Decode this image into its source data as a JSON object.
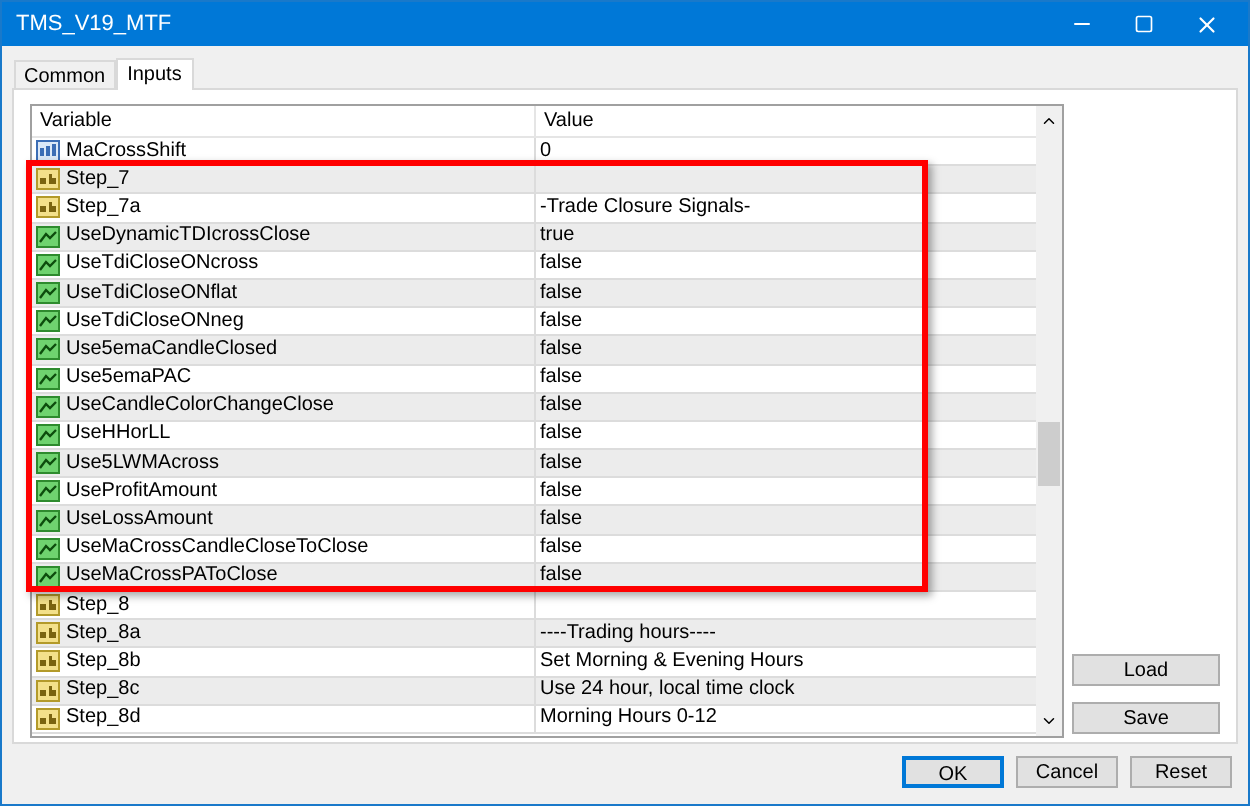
{
  "window": {
    "title": "TMS_V19_MTF"
  },
  "tabs": [
    {
      "label": "Common",
      "selected": false
    },
    {
      "label": "Inputs",
      "selected": true
    }
  ],
  "table": {
    "columns": [
      "Variable",
      "Value"
    ],
    "rows": [
      {
        "kind": "int",
        "variable": "MaCrossShift",
        "value": "0"
      },
      {
        "kind": "string",
        "variable": "Step_7",
        "value": ""
      },
      {
        "kind": "string",
        "variable": "Step_7a",
        "value": "-Trade Closure Signals-"
      },
      {
        "kind": "bool",
        "variable": "UseDynamicTDIcrossClose",
        "value": "true"
      },
      {
        "kind": "bool",
        "variable": "UseTdiCloseONcross",
        "value": "false"
      },
      {
        "kind": "bool",
        "variable": "UseTdiCloseONflat",
        "value": "false"
      },
      {
        "kind": "bool",
        "variable": "UseTdiCloseONneg",
        "value": "false"
      },
      {
        "kind": "bool",
        "variable": "Use5emaCandleClosed",
        "value": "false"
      },
      {
        "kind": "bool",
        "variable": "Use5emaPAC",
        "value": "false"
      },
      {
        "kind": "bool",
        "variable": "UseCandleColorChangeClose",
        "value": "false"
      },
      {
        "kind": "bool",
        "variable": "UseHHorLL",
        "value": "false"
      },
      {
        "kind": "bool",
        "variable": "Use5LWMAcross",
        "value": "false"
      },
      {
        "kind": "bool",
        "variable": "UseProfitAmount",
        "value": "false"
      },
      {
        "kind": "bool",
        "variable": "UseLossAmount",
        "value": "false"
      },
      {
        "kind": "bool",
        "variable": "UseMaCrossCandleCloseToClose",
        "value": "false"
      },
      {
        "kind": "bool",
        "variable": "UseMaCrossPAToClose",
        "value": "false"
      },
      {
        "kind": "string",
        "variable": "Step_8",
        "value": ""
      },
      {
        "kind": "string",
        "variable": "Step_8a",
        "value": "----Trading hours----"
      },
      {
        "kind": "string",
        "variable": "Step_8b",
        "value": "Set Morning & Evening Hours"
      },
      {
        "kind": "string",
        "variable": "Step_8c",
        "value": "Use 24 hour, local time clock"
      },
      {
        "kind": "string",
        "variable": "Step_8d",
        "value": "Morning Hours 0-12"
      }
    ]
  },
  "side_buttons": [
    "Load",
    "Save"
  ],
  "buttons": [
    "OK",
    "Cancel",
    "Reset"
  ]
}
